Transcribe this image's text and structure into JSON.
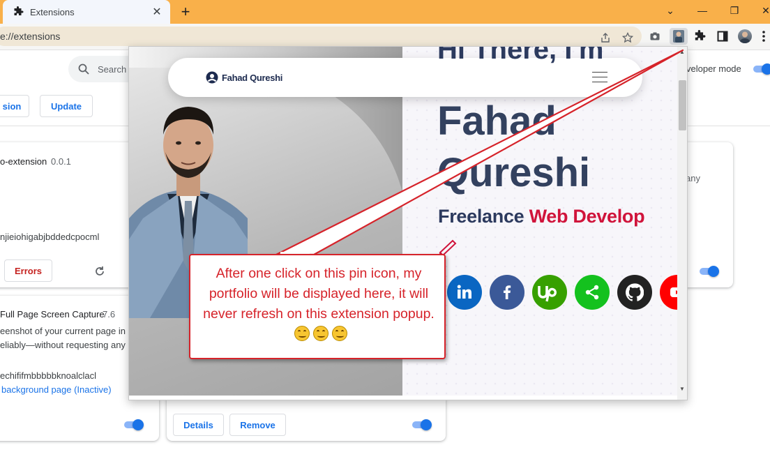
{
  "browser": {
    "tab_title": "Extensions",
    "close_label": "✕",
    "new_tab_label": "+",
    "url": "e://extensions",
    "window_controls": {
      "collapse": "⌄",
      "minimize": "—",
      "restore": "❐",
      "close": "✕"
    }
  },
  "extensions_page": {
    "search_placeholder": "Search",
    "developer_mode_label": "veloper mode",
    "buttons": {
      "load_unpacked": "sion",
      "update": "Update"
    },
    "cards": [
      {
        "name": "o-extension",
        "version": "0.0.1",
        "id": "njieiohigabjbddedcpocml",
        "errors_button": "Errors"
      },
      {
        "name": "Full Page Screen Capture",
        "version": "7.6",
        "description_line1": "eenshot of your current page in",
        "description_line2": "eliably—without requesting any ex",
        "id": "echififmbbbbbknoalclacl",
        "inspect_link": "background page (Inactive)"
      },
      {
        "details_button": "Details",
        "remove_button": "Remove"
      },
      {
        "partial_text": "any"
      }
    ]
  },
  "popup": {
    "brand_name": "Fahad Qureshi",
    "hero_greeting": "Hi There, I'm",
    "first_name": "Fahad",
    "last_name": "Qureshi",
    "role_part1": "Freelance",
    "role_part2": "Web Develop",
    "socials": [
      {
        "name": "linkedin",
        "color": "#0a66c2",
        "label": "in"
      },
      {
        "name": "facebook",
        "color": "#3b5998",
        "label": "f"
      },
      {
        "name": "upwork",
        "color": "#37a000",
        "label": "Up"
      },
      {
        "name": "share",
        "color": "#14c11e",
        "label": "share"
      },
      {
        "name": "github",
        "color": "#222222",
        "label": "github"
      },
      {
        "name": "youtube",
        "color": "#ff0000",
        "label": "yt"
      }
    ]
  },
  "annotation": {
    "text": "After one click on this pin icon, my portfolio will be displayed here, it will never refresh on this extension popup.",
    "color": "#d6232a"
  }
}
